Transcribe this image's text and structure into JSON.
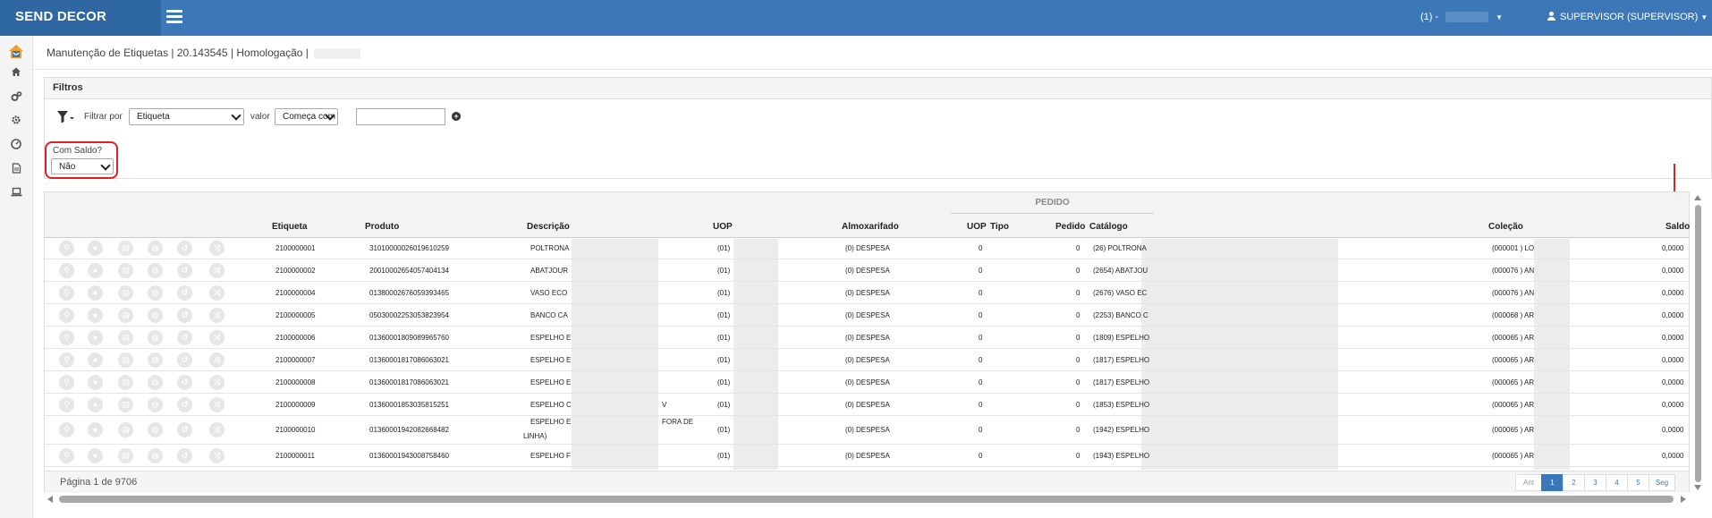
{
  "topbar": {
    "brand": "SEND DECOR",
    "org_selector": "(1) -",
    "user": "SUPERVISOR (SUPERVISOR)",
    "accent_color": "#3c78b7"
  },
  "sidebar": {
    "icons": [
      "home-icon",
      "cogs-icon",
      "gear-icon",
      "dashboard-icon",
      "document-icon",
      "laptop-icon"
    ]
  },
  "page": {
    "title": "Manutenção de Etiquetas | 20.143545 | Homologação |"
  },
  "filters": {
    "panel_title": "Filtros",
    "filter_by_label": "Filtrar por",
    "filter_by_value": "Etiqueta",
    "value_label": "valor",
    "match_value": "Começa com",
    "search_value": "",
    "com_saldo_label": "Com Saldo?",
    "com_saldo_value": "Não"
  },
  "grid": {
    "group_header": "PEDIDO",
    "columns": {
      "etiqueta": "Etiqueta",
      "produto": "Produto",
      "descricao": "Descrição",
      "uop": "UOP",
      "almoxarifado": "Almoxarifado",
      "uop_pedido": "UOP",
      "tipo": "Tipo",
      "pedido": "Pedido",
      "catalogo": "Catálogo",
      "colecao": "Coleção",
      "saldo": "Saldo"
    },
    "rows": [
      {
        "etiqueta": "2100000001",
        "produto": "3101000002601961025​9",
        "descricao": "POLTRONA",
        "desc2": "",
        "uop": "(01)",
        "almox": "(0) DESPESA",
        "uop_ped": "0",
        "pedido": "0",
        "catalogo": "(26) POLTRONA",
        "colecao": "(000001 ) LO",
        "saldo": "0,0000"
      },
      {
        "etiqueta": "2100000002",
        "produto": "20010002654057404134",
        "descricao": "ABATJOUR",
        "desc2": "",
        "uop": "(01)",
        "almox": "(0) DESPESA",
        "uop_ped": "0",
        "pedido": "0",
        "catalogo": "(2654) ABATJOU",
        "colecao": "(000076 ) AN",
        "saldo": "0,0000"
      },
      {
        "etiqueta": "2100000004",
        "produto": "01380002676059393465",
        "descricao": "VASO ECO",
        "desc2": "",
        "uop": "(01)",
        "almox": "(0) DESPESA",
        "uop_ped": "0",
        "pedido": "0",
        "catalogo": "(2676) VASO EC",
        "colecao": "(000076 ) AN",
        "saldo": "0,0000"
      },
      {
        "etiqueta": "2100000005",
        "produto": "05030002253053823954",
        "descricao": "BANCO CA",
        "desc2": "",
        "uop": "(01)",
        "almox": "(0) DESPESA",
        "uop_ped": "0",
        "pedido": "0",
        "catalogo": "(2253) BANCO C",
        "colecao": "(000068 ) AR",
        "saldo": "0,0000"
      },
      {
        "etiqueta": "2100000006",
        "produto": "01360001809089965760",
        "descricao": "ESPELHO E",
        "desc2": "",
        "uop": "(01)",
        "almox": "(0) DESPESA",
        "uop_ped": "0",
        "pedido": "0",
        "catalogo": "(1809) ESPELHO",
        "colecao": "(000065 ) AR",
        "saldo": "0,0000"
      },
      {
        "etiqueta": "2100000007",
        "produto": "01360001817086063021",
        "descricao": "ESPELHO E",
        "desc2": "",
        "uop": "(01)",
        "almox": "(0) DESPESA",
        "uop_ped": "0",
        "pedido": "0",
        "catalogo": "(1817) ESPELHO",
        "colecao": "(000065 ) AR",
        "saldo": "0,0000"
      },
      {
        "etiqueta": "2100000008",
        "produto": "01360001817086063021",
        "descricao": "ESPELHO E",
        "desc2": "",
        "uop": "(01)",
        "almox": "(0) DESPESA",
        "uop_ped": "0",
        "pedido": "0",
        "catalogo": "(1817) ESPELHO",
        "colecao": "(000065 ) AR",
        "saldo": "0,0000"
      },
      {
        "etiqueta": "2100000009",
        "produto": "01360001853035815251",
        "descricao": "ESPELHO C",
        "desc2": "V",
        "uop": "(01)",
        "almox": "(0) DESPESA",
        "uop_ped": "0",
        "pedido": "0",
        "catalogo": "(1853) ESPELHO",
        "colecao": "(000065 ) AR",
        "saldo": "0,0000"
      },
      {
        "etiqueta": "2100000010",
        "produto": "01360001942082668482",
        "descricao": "ESPELHO E",
        "desc2": "FORA DE",
        "desc3": "LINHA)",
        "uop": "(01)",
        "almox": "(0) DESPESA",
        "uop_ped": "0",
        "pedido": "0",
        "catalogo": "(1942) ESPELHO",
        "colecao": "(000065 ) AR",
        "saldo": "0,0000"
      },
      {
        "etiqueta": "2100000011",
        "produto": "01360001943008758460",
        "descricao": "ESPELHO F",
        "desc2": "",
        "uop": "(01)",
        "almox": "(0) DESPESA",
        "uop_ped": "0",
        "pedido": "0",
        "catalogo": "(1943) ESPELHO",
        "colecao": "(000065 ) AR",
        "saldo": "0,0000"
      }
    ],
    "action_icons": [
      "search-icon",
      "tag-icon",
      "document-icon",
      "globe-icon",
      "history-icon",
      "shuffle-icon"
    ]
  },
  "footer": {
    "page_label": "Página 1 de 9706",
    "pager": [
      "Ant",
      "1",
      "2",
      "3",
      "4",
      "5",
      "Seg"
    ],
    "active_page": "1"
  }
}
